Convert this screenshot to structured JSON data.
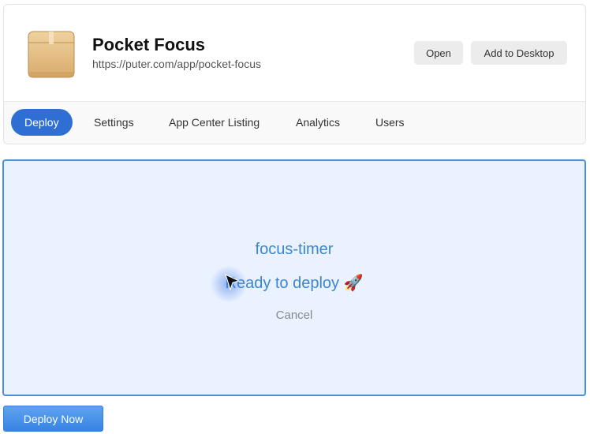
{
  "app": {
    "title": "Pocket Focus",
    "url": "https://puter.com/app/pocket-focus",
    "icon": "package-box-icon"
  },
  "header_buttons": {
    "open_label": "Open",
    "add_to_desktop_label": "Add to Desktop"
  },
  "tabs": [
    {
      "label": "Deploy",
      "active": true
    },
    {
      "label": "Settings",
      "active": false
    },
    {
      "label": "App Center Listing",
      "active": false
    },
    {
      "label": "Analytics",
      "active": false
    },
    {
      "label": "Users",
      "active": false
    }
  ],
  "dropzone": {
    "folder_name": "focus-timer",
    "status": "Ready to deploy 🚀",
    "cancel_label": "Cancel"
  },
  "deploy_button_label": "Deploy Now",
  "colors": {
    "accent": "#2f6fd4",
    "dropzone_bg": "#eaf1ff",
    "dropzone_border": "#4a8fd8",
    "dropzone_text": "#3b86d1"
  }
}
